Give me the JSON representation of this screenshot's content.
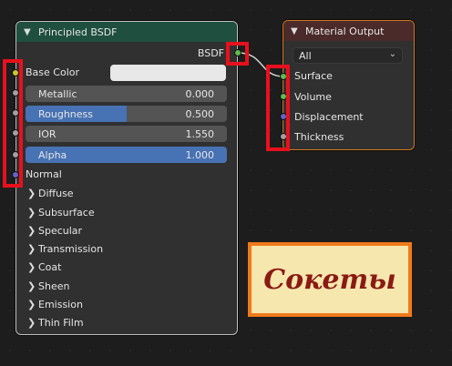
{
  "bsdf_node": {
    "title": "Principled BSDF",
    "output_label": "BSDF",
    "base_color_label": "Base Color",
    "normal_label": "Normal",
    "fields": [
      {
        "label": "Metallic",
        "value": "0.000",
        "fraction": 0.0
      },
      {
        "label": "Roughness",
        "value": "0.500",
        "fraction": 0.5
      },
      {
        "label": "IOR",
        "value": "1.550",
        "fraction": 0.0
      },
      {
        "label": "Alpha",
        "value": "1.000",
        "fraction": 1.0
      }
    ],
    "sections": [
      "Diffuse",
      "Subsurface",
      "Specular",
      "Transmission",
      "Coat",
      "Sheen",
      "Emission",
      "Thin Film"
    ]
  },
  "output_node": {
    "title": "Material Output",
    "target": "All",
    "inputs": [
      "Surface",
      "Volume",
      "Displacement",
      "Thickness"
    ]
  },
  "annotation": {
    "text": "Сокеты"
  },
  "colors": {
    "bsdf_header": "#1f4f3f",
    "output_header": "#4b2a2a",
    "field_fill": "#4772b3",
    "highlight": "#e8101c",
    "note_border": "#f07a1a",
    "note_bg": "#f5e7ae",
    "note_text": "#8a1a14"
  }
}
